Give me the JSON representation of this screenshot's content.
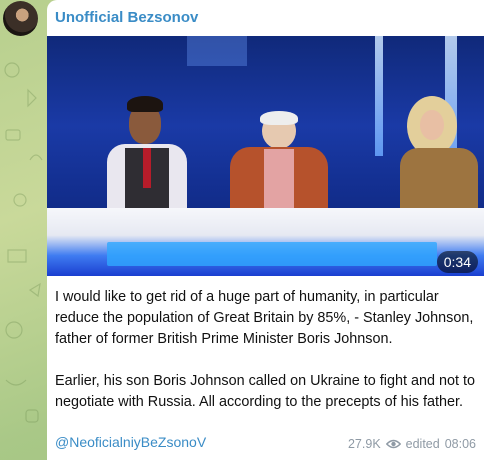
{
  "channel": {
    "name": "Unofficial Bezsonov"
  },
  "media": {
    "duration": "0:34"
  },
  "message": {
    "paragraphs": [
      "I would like to get rid of a huge part of humanity, in particular reduce the population of Great Britain by 85%, - Stanley Johnson, father of former British Prime Minister Boris Johnson.",
      "Earlier, his son Boris Johnson called on Ukraine to fight and not to negotiate with Russia. All according to the precepts of his father."
    ],
    "link": "@NeoficialniyBeZsonoV"
  },
  "footer": {
    "views": "27.9K",
    "edited": "edited",
    "time": "08:06"
  },
  "icons": {
    "views": "eye-icon"
  }
}
